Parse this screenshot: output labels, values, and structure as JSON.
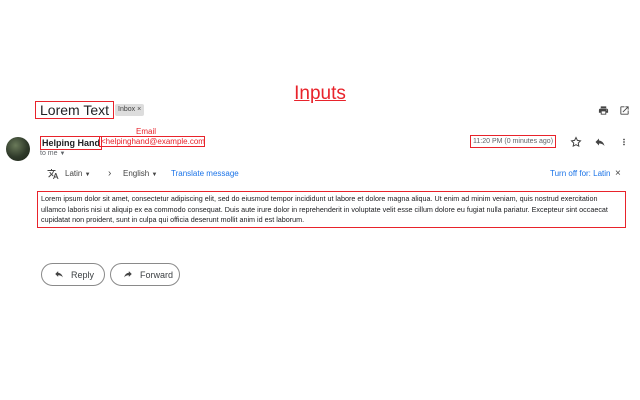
{
  "annotation": {
    "section_label": "Inputs",
    "email_label": "Email"
  },
  "email": {
    "subject": "Lorem Text",
    "inbox_chip": "Inbox",
    "inbox_chip_close": "×",
    "sender_name": "Helping Hand",
    "sender_email": "<helpinghand@example.com>",
    "to_me": "to me",
    "timestamp": "11:20 PM (0 minutes ago)",
    "body": "Lorem ipsum dolor sit amet, consectetur adipiscing elit, sed do eiusmod tempor incididunt ut labore et dolore magna aliqua. Ut enim ad minim veniam, quis nostrud exercitation ullamco laboris nisi ut aliquip ex ea commodo consequat. Duis aute irure dolor in reprehenderit in voluptate velit esse cillum dolore eu fugiat nulla pariatur. Excepteur sint occaecat cupidatat non proident, sunt in culpa qui officia deserunt mollit anim id est laborum."
  },
  "translate": {
    "source_language": "Latin",
    "target_language": "English",
    "translate_link": "Translate message",
    "turn_off": "Turn off for: Latin",
    "close": "×"
  },
  "actions": {
    "reply": "Reply",
    "forward": "Forward"
  },
  "icons": {
    "print": "print-icon",
    "open_new_window": "open-in-new-icon",
    "star": "star-icon",
    "reply": "reply-icon",
    "more": "more-vert-icon",
    "translate": "translate-icon"
  },
  "colors": {
    "annotation": "#e8232b",
    "link": "#1a73e8"
  }
}
